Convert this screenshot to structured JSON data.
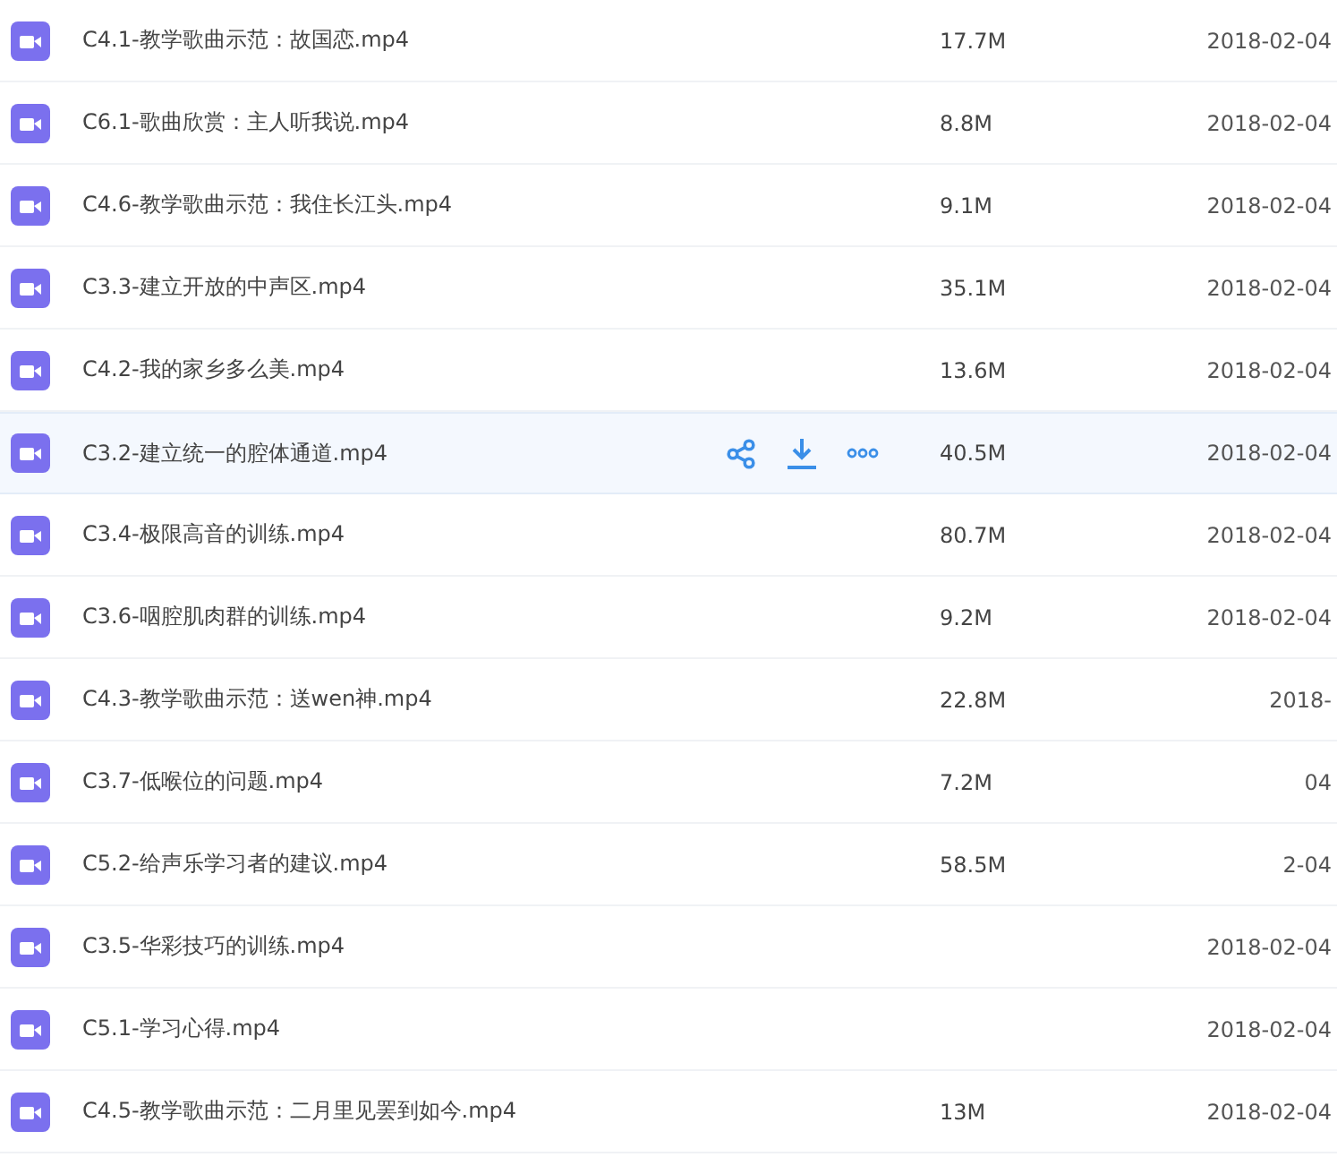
{
  "files": [
    {
      "name": "C4.1-教学歌曲示范：故国恋.mp4",
      "size": "17.7M",
      "date": "2018-02-04",
      "hovered": false
    },
    {
      "name": "C6.1-歌曲欣赏：主人听我说.mp4",
      "size": "8.8M",
      "date": "2018-02-04",
      "hovered": false
    },
    {
      "name": "C4.6-教学歌曲示范：我住长江头.mp4",
      "size": "9.1M",
      "date": "2018-02-04",
      "hovered": false
    },
    {
      "name": "C3.3-建立开放的中声区.mp4",
      "size": "35.1M",
      "date": "2018-02-04",
      "hovered": false
    },
    {
      "name": "C4.2-我的家乡多么美.mp4",
      "size": "13.6M",
      "date": "2018-02-04",
      "hovered": false
    },
    {
      "name": "C3.2-建立统一的腔体通道.mp4",
      "size": "40.5M",
      "date": "2018-02-04",
      "hovered": true
    },
    {
      "name": "C3.4-极限高音的训练.mp4",
      "size": "80.7M",
      "date": "2018-02-04",
      "hovered": false
    },
    {
      "name": "C3.6-咽腔肌肉群的训练.mp4",
      "size": "9.2M",
      "date": "2018-02-04",
      "hovered": false
    },
    {
      "name": "C4.3-教学歌曲示范：送wen神.mp4",
      "size": "22.8M",
      "date": "2018-",
      "hovered": false
    },
    {
      "name": "C3.7-低喉位的问题.mp4",
      "size": "7.2M",
      "date": "04",
      "hovered": false
    },
    {
      "name": "C5.2-给声乐学习者的建议.mp4",
      "size": "58.5M",
      "date": "2-04",
      "hovered": false
    },
    {
      "name": "C3.5-华彩技巧的训练.mp4",
      "date": "2018-02-04",
      "hovered": false
    },
    {
      "name": "C5.1-学习心得.mp4",
      "date": "2018-02-04",
      "hovered": false
    },
    {
      "name": "C4.5-教学歌曲示范：二月里见罢到如今.mp4",
      "size": "13M",
      "date": "2018-02-04",
      "hovered": false
    }
  ]
}
